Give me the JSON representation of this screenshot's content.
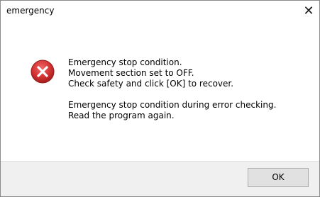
{
  "window": {
    "title": "emergency",
    "close_glyph": "✕"
  },
  "icon": {
    "name": "error-icon",
    "color": "#c42b2b"
  },
  "message": {
    "lines": [
      "Emergency stop condition.",
      "Movement section set to OFF.",
      "Check safety and click [OK] to recover.",
      "Emergency stop condition during error checking.",
      "Read the program again."
    ]
  },
  "buttons": {
    "ok_label": "OK"
  }
}
